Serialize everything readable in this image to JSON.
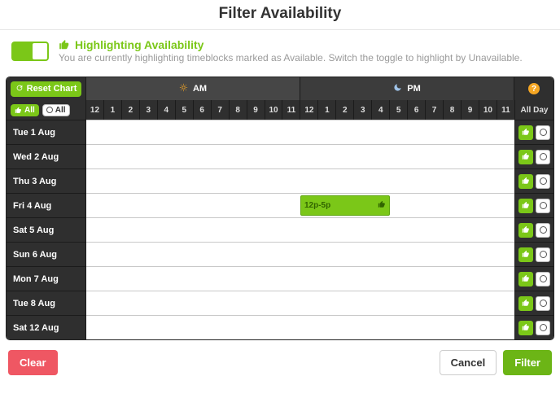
{
  "title": "Filter Availability",
  "toggle": {
    "heading": "Highlighting Availability",
    "desc": "You are currently highlighting timeblocks marked as Available. Switch the toggle to highlight by Unavailable.",
    "state": "on"
  },
  "reset_label": "Reset Chart",
  "period": {
    "am": "AM",
    "pm": "PM"
  },
  "quick": {
    "all_on": "All",
    "all_off": "All"
  },
  "hours": [
    "12",
    "1",
    "2",
    "3",
    "4",
    "5",
    "6",
    "7",
    "8",
    "9",
    "10",
    "11",
    "12",
    "1",
    "2",
    "3",
    "4",
    "5",
    "6",
    "7",
    "8",
    "9",
    "10",
    "11"
  ],
  "all_day_label": "All Day",
  "help_label": "?",
  "days": [
    {
      "label": "Tue 1 Aug",
      "blocks": []
    },
    {
      "label": "Wed 2 Aug",
      "blocks": []
    },
    {
      "label": "Thu 3 Aug",
      "blocks": []
    },
    {
      "label": "Fri 4 Aug",
      "blocks": [
        {
          "start_hour_index": 12,
          "end_hour_index": 17,
          "label": "12p-5p"
        }
      ]
    },
    {
      "label": "Sat 5 Aug",
      "blocks": []
    },
    {
      "label": "Sun 6 Aug",
      "blocks": []
    },
    {
      "label": "Mon 7 Aug",
      "blocks": []
    },
    {
      "label": "Tue 8 Aug",
      "blocks": []
    },
    {
      "label": "Sat 12 Aug",
      "blocks": []
    }
  ],
  "footer": {
    "clear": "Clear",
    "cancel": "Cancel",
    "filter": "Filter"
  },
  "colors": {
    "accent": "#7bc718",
    "dark": "#2f2f2f",
    "danger": "#ef5763"
  }
}
